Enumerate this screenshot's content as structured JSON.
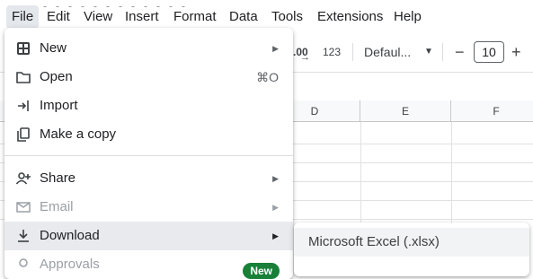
{
  "menubar": {
    "items": [
      "File",
      "Edit",
      "View",
      "Insert",
      "Format",
      "Data",
      "Tools",
      "Extensions",
      "Help"
    ]
  },
  "toolbar": {
    "decimal_label": ".00",
    "format_123": "123",
    "font_name": "Defaul...",
    "font_size": "10",
    "minus": "−",
    "plus": "+"
  },
  "grid": {
    "columns": [
      "D",
      "E",
      "F"
    ]
  },
  "file_menu": {
    "items": [
      {
        "label": "New",
        "icon": "new-sheet-icon",
        "submenu": true
      },
      {
        "label": "Open",
        "icon": "folder-icon",
        "shortcut": "⌘O"
      },
      {
        "label": "Import",
        "icon": "import-icon"
      },
      {
        "label": "Make a copy",
        "icon": "copy-icon"
      },
      {
        "label": "Share",
        "icon": "share-icon",
        "submenu": true
      },
      {
        "label": "Email",
        "icon": "email-icon",
        "submenu": true,
        "disabled": true
      },
      {
        "label": "Download",
        "icon": "download-icon",
        "submenu": true,
        "highlighted": true
      },
      {
        "label": "Approvals",
        "icon": "approvals-icon",
        "badge": "New"
      }
    ]
  },
  "download_submenu": {
    "items": [
      {
        "label": "Microsoft Excel (.xlsx)"
      }
    ]
  },
  "colors": {
    "menu_highlight": "#e8eaed",
    "badge_green": "#188038",
    "disabled_text": "#9aa0a6"
  }
}
